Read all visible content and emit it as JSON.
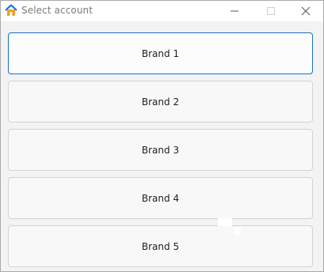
{
  "window": {
    "title": "Select account",
    "app_icon": "home-icon",
    "controls": {
      "minimize_icon": "minimize-icon",
      "maximize_icon": "maximize-icon",
      "close_icon": "close-icon"
    }
  },
  "brands": [
    {
      "label": "Brand 1",
      "focused": true
    },
    {
      "label": "Brand 2",
      "focused": false
    },
    {
      "label": "Brand 3",
      "focused": false
    },
    {
      "label": "Brand 4",
      "focused": false
    },
    {
      "label": "Brand 5",
      "focused": false
    }
  ],
  "colors": {
    "focus_border": "#1a6fbf",
    "icon_roof": "#1f6fcf",
    "icon_house": "#f0a020"
  }
}
